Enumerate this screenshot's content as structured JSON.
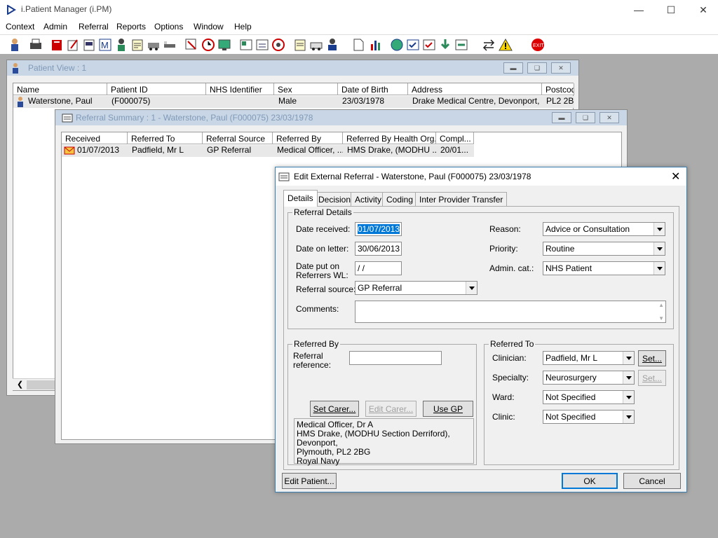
{
  "app": {
    "title": "i.Patient Manager (i.PM)"
  },
  "menu": [
    "Context",
    "Admin",
    "Referral",
    "Reports",
    "Options",
    "Window",
    "Help"
  ],
  "patient_view": {
    "title": "Patient View : 1",
    "columns": [
      "Name",
      "Patient ID",
      "NHS Identifier",
      "Sex",
      "Date of Birth",
      "Address",
      "Postcod"
    ],
    "row": [
      "Waterstone, Paul",
      "(F000075)",
      "",
      "Male",
      "23/03/1978",
      "Drake Medical Centre, Devonport, ...",
      "PL2 2B"
    ]
  },
  "referral_summary": {
    "title": "Referral Summary : 1 - Waterstone, Paul (F000075) 23/03/1978",
    "columns": [
      "Received",
      "Referred To",
      "Referral Source",
      "Referred By",
      "Referred By Health Org.",
      "Compl..."
    ],
    "row": [
      "01/07/2013",
      "Padfield, Mr L",
      "GP Referral",
      "Medical Officer, ...",
      "HMS Drake, (MODHU ...",
      "20/01..."
    ]
  },
  "dialog": {
    "title": "Edit External Referral - Waterstone, Paul (F000075) 23/03/1978",
    "tabs": [
      "Details",
      "Decision",
      "Activity",
      "Coding",
      "Inter Provider Transfer"
    ],
    "referral_details": {
      "legend": "Referral Details",
      "date_received_label": "Date received:",
      "date_received": "01/07/2013",
      "date_on_letter_label": "Date on letter:",
      "date_on_letter": "30/06/2013",
      "date_put_on_label1": "Date put on",
      "date_put_on_label2": "Referrers WL:",
      "date_put_on": " /  /",
      "referral_source_label": "Referral source:",
      "referral_source": "GP Referral",
      "comments_label": "Comments:",
      "reason_label": "Reason:",
      "reason": "Advice or Consultation",
      "priority_label": "Priority:",
      "priority": "Routine",
      "admin_cat_label": "Admin. cat.:",
      "admin_cat": "NHS Patient"
    },
    "referred_by": {
      "legend": "Referred By",
      "ref_label1": "Referral",
      "ref_label2": "reference:",
      "set_carer": "Set Carer...",
      "edit_carer": "Edit Carer...",
      "use_gp": "Use GP",
      "address": [
        "Medical Officer, Dr A",
        "HMS Drake, (MODHU Section Derriford), Devonport,",
        "Plymouth, PL2 2BG",
        "Royal Navy"
      ]
    },
    "referred_to": {
      "legend": "Referred To",
      "clinician_label": "Clinician:",
      "clinician": "Padfield, Mr L",
      "specialty_label": "Specialty:",
      "specialty": "Neurosurgery",
      "ward_label": "Ward:",
      "ward": "Not Specified",
      "clinic_label": "Clinic:",
      "clinic": "Not Specified",
      "set": "Set..."
    },
    "edit_patient": "Edit Patient...",
    "ok": "OK",
    "cancel": "Cancel"
  }
}
